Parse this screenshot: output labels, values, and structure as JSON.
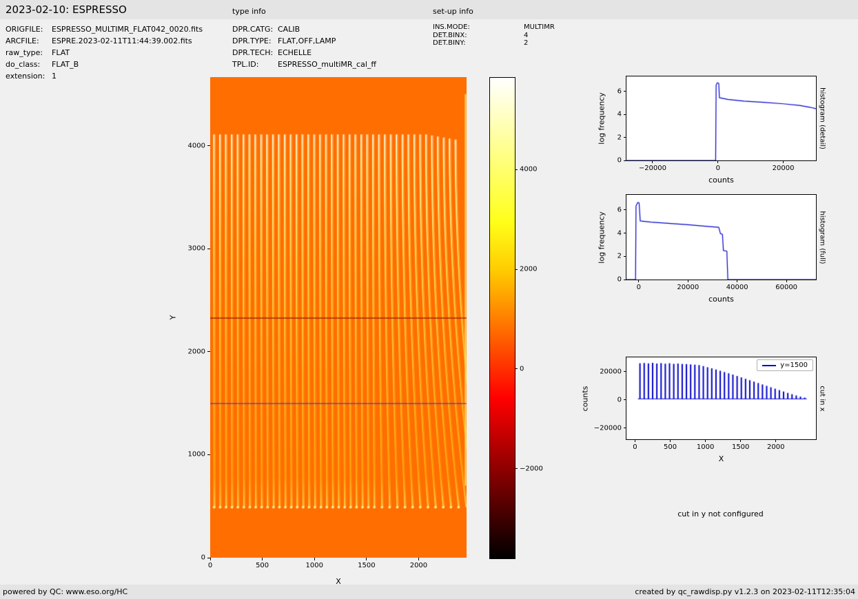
{
  "header": {
    "title": "2023-02-10: ESPRESSO",
    "type_info_label": "type info",
    "setup_info_label": "set-up info"
  },
  "file_info": {
    "rows": [
      {
        "label": "ORIGFILE:",
        "value": "ESPRESSO_MULTIMR_FLAT042_0020.fits"
      },
      {
        "label": "ARCFILE:",
        "value": "ESPRE.2023-02-11T11:44:39.002.fits"
      },
      {
        "label": "raw_type:",
        "value": "FLAT"
      },
      {
        "label": "do_class:",
        "value": "FLAT_B"
      },
      {
        "label": "extension:",
        "value": "1"
      }
    ]
  },
  "type_info": {
    "rows": [
      {
        "label": "DPR.CATG:",
        "value": "CALIB"
      },
      {
        "label": "DPR.TYPE:",
        "value": "FLAT,OFF,LAMP"
      },
      {
        "label": "DPR.TECH:",
        "value": "ECHELLE"
      },
      {
        "label": "TPL.ID:",
        "value": "ESPRESSO_multiMR_cal_ff"
      }
    ]
  },
  "setup_info": {
    "rows": [
      {
        "label": "INS.MODE:",
        "value": "MULTIMR"
      },
      {
        "label": "DET.BINX:",
        "value": "4"
      },
      {
        "label": "DET.BINY:",
        "value": "2"
      }
    ]
  },
  "notes": {
    "cut_in_y": "cut in y not configured"
  },
  "footer": {
    "left": "powered by QC: www.eso.org/HC",
    "right": "created by qc_rawdisp.py v1.2.3 on 2023-02-11T12:35:04"
  },
  "chart_data": [
    {
      "id": "main-image",
      "type": "heatmap",
      "xlabel": "X",
      "ylabel": "Y",
      "xlim": [
        0,
        2460
      ],
      "ylim": [
        0,
        4666
      ],
      "xticks": [
        0,
        500,
        1000,
        1500,
        2000
      ],
      "yticks": [
        0,
        1000,
        2000,
        3000,
        4000
      ],
      "bg_color": "#ff6e00",
      "colormap": "hot",
      "description": "ESPRESSO multiMR raw flat: ~42 bright echelle order stripe pairs spanning y 490-4110, curving right on the right side",
      "orders": {
        "count": 42,
        "x_first": 35,
        "x_spacing": 56.5,
        "y_bottom": 490,
        "y_top": 4110
      },
      "dark_row_y": 2330,
      "right_edge_streak_x": 2450,
      "cut_line": {
        "y": 1500,
        "color": "#2a2ad0"
      },
      "colorbar": {
        "vmin": -3800,
        "vmax": 5840,
        "ticks": [
          4000,
          2000,
          0,
          -2000
        ]
      }
    },
    {
      "id": "hist-detail",
      "type": "line",
      "title_right": "histogram (detail)",
      "xlabel": "counts",
      "ylabel": "log frequency",
      "xlim": [
        -28000,
        30000
      ],
      "ylim": [
        0,
        7.3
      ],
      "xticks": [
        -20000,
        0,
        20000
      ],
      "yticks": [
        0,
        2,
        4,
        6
      ],
      "color": "#0000cc",
      "points": [
        [
          -28000,
          0
        ],
        [
          -700,
          0
        ],
        [
          -550,
          6.55
        ],
        [
          -200,
          6.75
        ],
        [
          250,
          6.7
        ],
        [
          450,
          5.45
        ],
        [
          3000,
          5.3
        ],
        [
          8000,
          5.15
        ],
        [
          14000,
          5.05
        ],
        [
          20000,
          4.92
        ],
        [
          25000,
          4.78
        ],
        [
          28200,
          4.62
        ],
        [
          30000,
          4.5
        ]
      ]
    },
    {
      "id": "hist-full",
      "type": "line",
      "title_right": "histogram (full)",
      "xlabel": "counts",
      "ylabel": "log frequency",
      "xlim": [
        -5000,
        72000
      ],
      "ylim": [
        0,
        7.3
      ],
      "xticks": [
        0,
        20000,
        40000,
        60000
      ],
      "yticks": [
        0,
        2,
        4,
        6
      ],
      "color": "#0000cc",
      "points": [
        [
          -5000,
          0
        ],
        [
          -1300,
          0
        ],
        [
          -1100,
          6.35
        ],
        [
          -400,
          6.65
        ],
        [
          150,
          6.6
        ],
        [
          600,
          5.05
        ],
        [
          5000,
          4.95
        ],
        [
          12000,
          4.85
        ],
        [
          20000,
          4.72
        ],
        [
          28000,
          4.58
        ],
        [
          32500,
          4.5
        ],
        [
          33200,
          3.95
        ],
        [
          34000,
          3.9
        ],
        [
          34400,
          2.5
        ],
        [
          35800,
          2.45
        ],
        [
          36200,
          0
        ],
        [
          72000,
          0
        ]
      ]
    },
    {
      "id": "cut-in-x",
      "type": "comb",
      "title_right": "cut in x",
      "legend": "y=1500",
      "xlabel": "X",
      "ylabel": "counts",
      "xlim": [
        -122,
        2570
      ],
      "ylim": [
        -28000,
        30000
      ],
      "xticks": [
        0,
        500,
        1000,
        1500,
        2000
      ],
      "yticks": [
        -20000,
        0,
        20000
      ],
      "color": "#0000cc",
      "baseline": 600,
      "spikes": [
        [
          70,
          25800
        ],
        [
          130,
          26000
        ],
        [
          190,
          25700
        ],
        [
          250,
          26100
        ],
        [
          310,
          25600
        ],
        [
          370,
          25900
        ],
        [
          430,
          25500
        ],
        [
          490,
          25800
        ],
        [
          550,
          25400
        ],
        [
          610,
          25600
        ],
        [
          670,
          25300
        ],
        [
          730,
          25200
        ],
        [
          790,
          25000
        ],
        [
          850,
          24800
        ],
        [
          910,
          24500
        ],
        [
          970,
          23800
        ],
        [
          1030,
          23000
        ],
        [
          1090,
          22200
        ],
        [
          1150,
          21400
        ],
        [
          1210,
          20500
        ],
        [
          1270,
          19600
        ],
        [
          1330,
          18700
        ],
        [
          1390,
          17800
        ],
        [
          1450,
          16800
        ],
        [
          1510,
          15800
        ],
        [
          1570,
          14800
        ],
        [
          1630,
          13800
        ],
        [
          1690,
          12800
        ],
        [
          1750,
          11800
        ],
        [
          1810,
          10800
        ],
        [
          1870,
          9800
        ],
        [
          1930,
          8800
        ],
        [
          1990,
          7800
        ],
        [
          2050,
          6800
        ],
        [
          2110,
          5800
        ],
        [
          2170,
          4800
        ],
        [
          2230,
          3900
        ],
        [
          2290,
          3000
        ],
        [
          2350,
          2200
        ],
        [
          2410,
          1500
        ]
      ]
    }
  ]
}
